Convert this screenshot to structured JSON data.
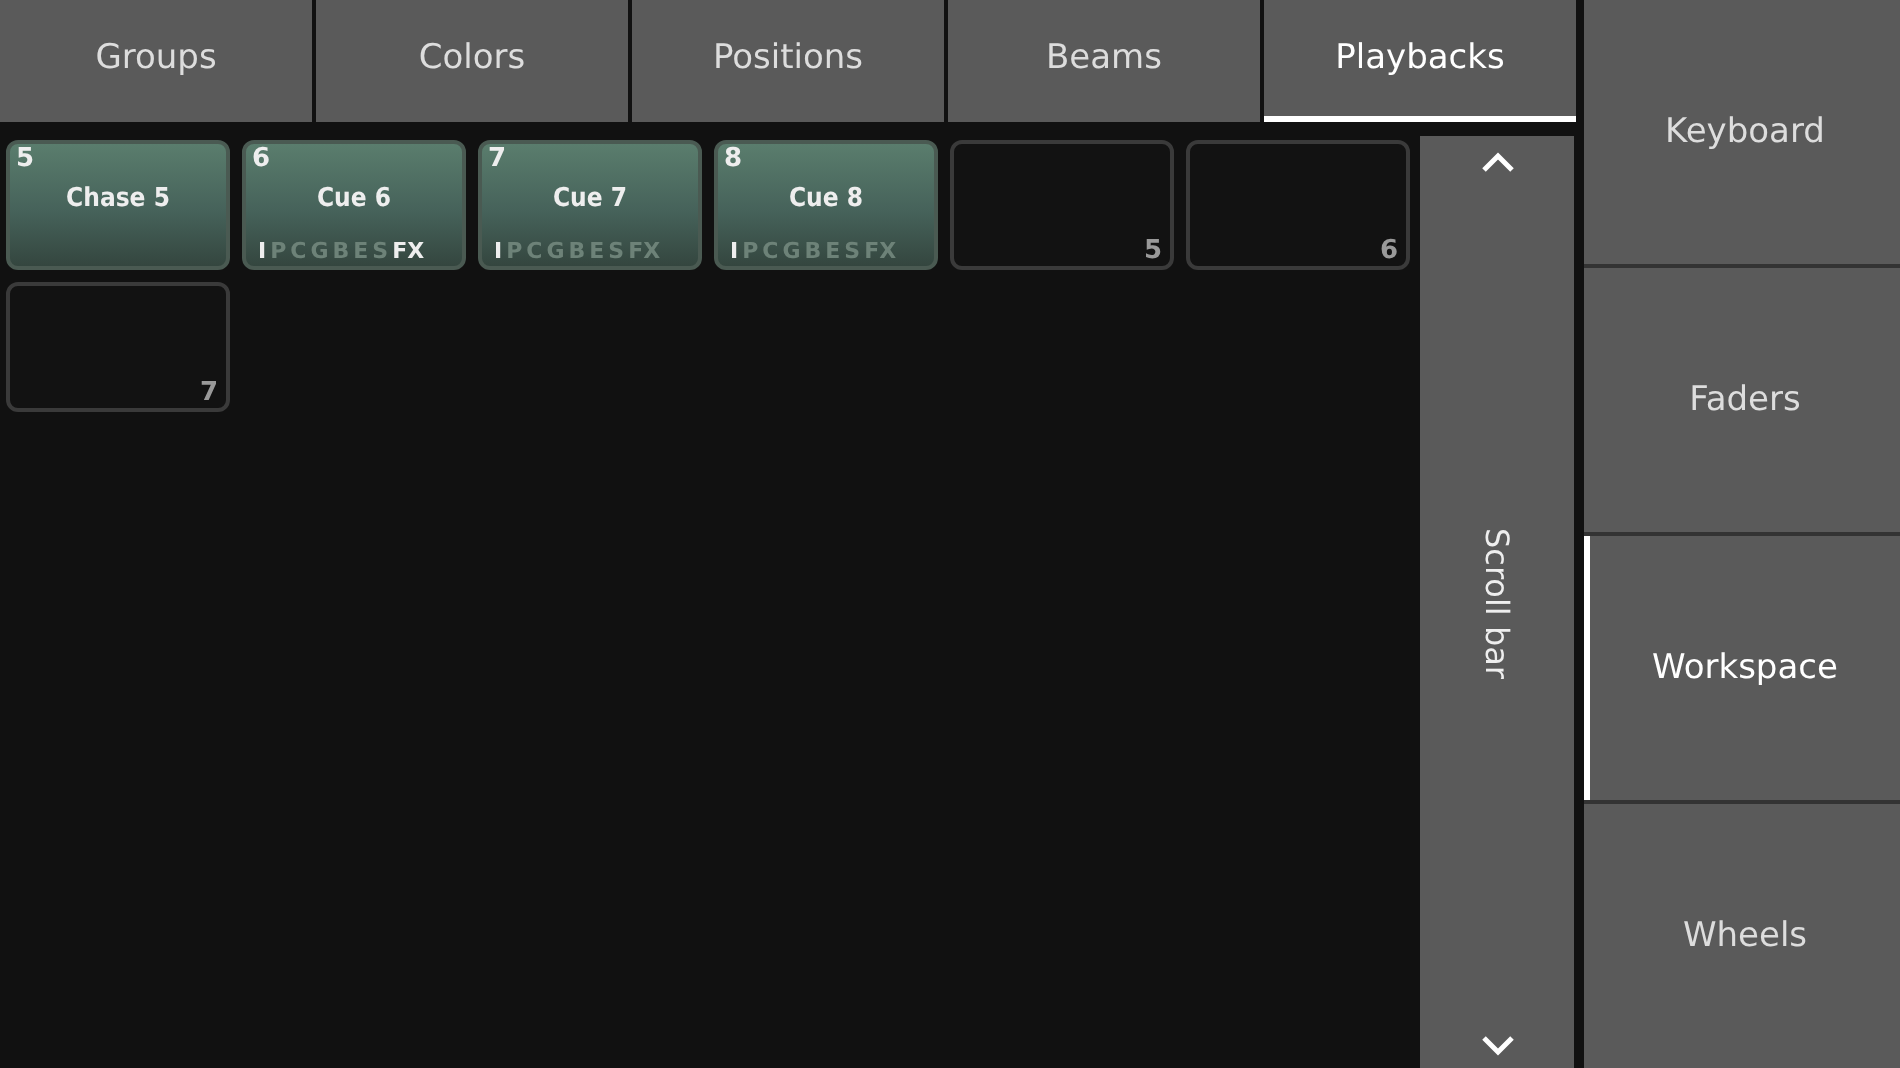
{
  "tabs": [
    {
      "label": "Groups",
      "selected": false
    },
    {
      "label": "Colors",
      "selected": false
    },
    {
      "label": "Positions",
      "selected": false
    },
    {
      "label": "Beams",
      "selected": false
    },
    {
      "label": "Playbacks",
      "selected": true
    }
  ],
  "playbacks": [
    {
      "kind": "filled",
      "number": "5",
      "name": "Chase 5"
    },
    {
      "kind": "filled",
      "number": "6",
      "name": "Cue 6",
      "flags": [
        {
          "label": "I",
          "on": true
        },
        {
          "label": "P",
          "on": false
        },
        {
          "label": "C",
          "on": false
        },
        {
          "label": "G",
          "on": false
        },
        {
          "label": "B",
          "on": false
        },
        {
          "label": "E",
          "on": false
        },
        {
          "label": "S",
          "on": false
        },
        {
          "label": "FX",
          "on": true
        }
      ]
    },
    {
      "kind": "filled",
      "number": "7",
      "name": "Cue 7",
      "flags": [
        {
          "label": "I",
          "on": true
        },
        {
          "label": "P",
          "on": false
        },
        {
          "label": "C",
          "on": false
        },
        {
          "label": "G",
          "on": false
        },
        {
          "label": "B",
          "on": false
        },
        {
          "label": "E",
          "on": false
        },
        {
          "label": "S",
          "on": false
        },
        {
          "label": "FX",
          "on": false
        }
      ]
    },
    {
      "kind": "filled",
      "number": "8",
      "name": "Cue 8",
      "flags": [
        {
          "label": "I",
          "on": true
        },
        {
          "label": "P",
          "on": false
        },
        {
          "label": "C",
          "on": false
        },
        {
          "label": "G",
          "on": false
        },
        {
          "label": "B",
          "on": false
        },
        {
          "label": "E",
          "on": false
        },
        {
          "label": "S",
          "on": false
        },
        {
          "label": "FX",
          "on": false
        }
      ]
    },
    {
      "kind": "empty",
      "number": "5"
    },
    {
      "kind": "empty",
      "number": "6"
    },
    {
      "kind": "empty",
      "number": "7"
    }
  ],
  "scroll_bar": {
    "label": "Scroll bar"
  },
  "side_buttons": [
    {
      "label": "Keyboard",
      "selected": false
    },
    {
      "label": "Faders",
      "selected": false
    },
    {
      "label": "Workspace",
      "selected": true
    },
    {
      "label": "Wheels",
      "selected": false
    }
  ]
}
